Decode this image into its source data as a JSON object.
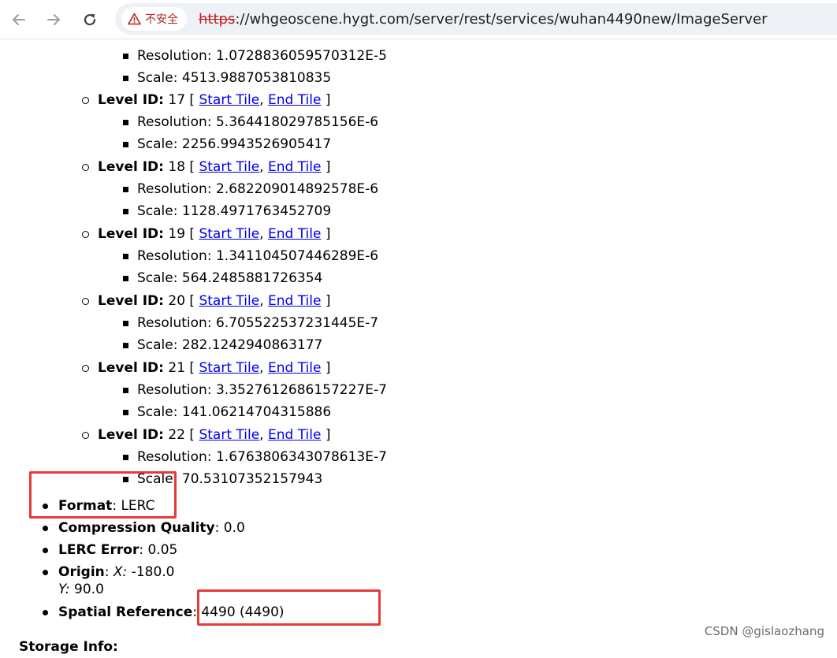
{
  "browser": {
    "security_label": "不安全",
    "url_scheme": "https",
    "url_rest": "://whgeoscene.hygt.com/server/rest/services/wuhan4490new/ImageServer"
  },
  "labels": {
    "resolution": "Resolution:",
    "scale": "Scale:",
    "level_id": "Level ID:",
    "bracket_open": "[",
    "bracket_close": "]",
    "comma": ",",
    "start_tile": "Start Tile",
    "end_tile": "End Tile"
  },
  "top_partial": {
    "resolution": "1.0728836059570312E-5",
    "scale": "4513.9887053810835"
  },
  "levels": [
    {
      "id": "17",
      "resolution": "5.364418029785156E-6",
      "scale": "2256.9943526905417"
    },
    {
      "id": "18",
      "resolution": "2.682209014892578E-6",
      "scale": "1128.4971763452709"
    },
    {
      "id": "19",
      "resolution": "1.341104507446289E-6",
      "scale": "564.2485881726354"
    },
    {
      "id": "20",
      "resolution": "6.705522537231445E-7",
      "scale": "282.1242940863177"
    },
    {
      "id": "21",
      "resolution": "3.3527612686157227E-7",
      "scale": "141.06214704315886"
    },
    {
      "id": "22",
      "resolution": "1.6763806343078613E-7",
      "scale": "70.53107352157943"
    }
  ],
  "props": {
    "format_label": "Format",
    "format_value": ": LERC",
    "compression_label": "Compression Quality",
    "compression_value": ": 0.0",
    "lerc_label": "LERC Error",
    "lerc_value": ": 0.05",
    "origin_label": "Origin",
    "origin_sep": ": ",
    "origin_x_label": "X:",
    "origin_x_value": " -180.0",
    "origin_y_label": "Y:",
    "origin_y_value": " 90.0",
    "spatial_label": "Spatial Reference",
    "spatial_value": ": 4490  (4490)",
    "storage_label": "Storage Info:"
  },
  "watermark": "CSDN @gislaozhang",
  "colors": {
    "annotation": "#e43a3a",
    "link": "#0000ee",
    "warning": "#b3261e"
  }
}
